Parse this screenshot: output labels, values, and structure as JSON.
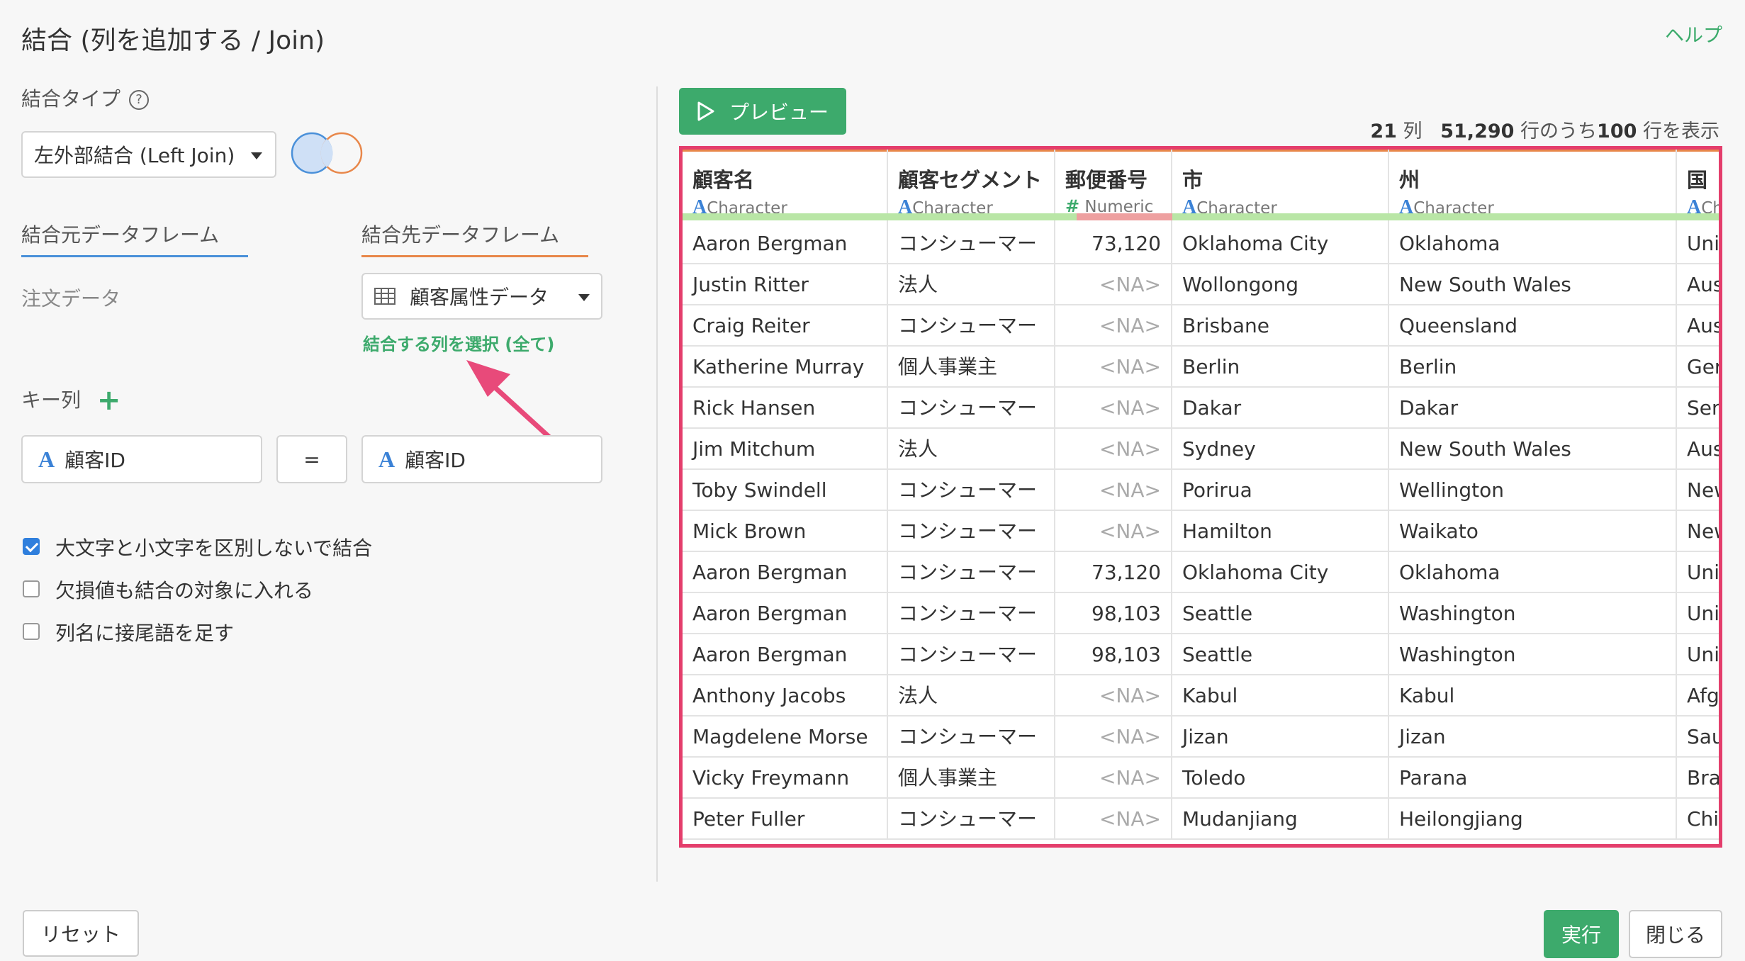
{
  "dialog": {
    "title": "結合 (列を追加する / Join)",
    "help_label": "ヘルプ"
  },
  "join_type": {
    "label": "結合タイプ",
    "help_icon": "?",
    "selected": "左外部結合 (Left Join)"
  },
  "source": {
    "tab_label": "結合元データフレーム",
    "value": "注文データ"
  },
  "target": {
    "tab_label": "結合先データフレーム",
    "selected": "顧客属性データ",
    "select_columns_link": "結合する列を選択 (全て)"
  },
  "key_columns": {
    "label": "キー列",
    "add_icon": "+",
    "left": "顧客ID",
    "operator": "=",
    "right": "顧客ID"
  },
  "options": [
    {
      "label": "大文字と小文字を区別しないで結合",
      "checked": true
    },
    {
      "label": "欠損値も結合の対象に入れる",
      "checked": false
    },
    {
      "label": "列名に接尾語を足す",
      "checked": false
    }
  ],
  "preview": {
    "button_label": "プレビュー",
    "stats": {
      "cols": "21",
      "cols_unit": "列",
      "total": "51,290",
      "total_unit": "行のうち",
      "shown": "100",
      "shown_unit": "行を表示"
    },
    "columns": [
      {
        "name": "顧客名",
        "type": "Character",
        "type_icon": "A"
      },
      {
        "name": "顧客セグメント",
        "type": "Character",
        "type_icon": "A"
      },
      {
        "name": "郵便番号",
        "type": "Numeric",
        "type_icon": "#"
      },
      {
        "name": "市",
        "type": "Character",
        "type_icon": "A"
      },
      {
        "name": "州",
        "type": "Character",
        "type_icon": "A"
      },
      {
        "name": "国",
        "type": "Character",
        "type_icon": "A"
      }
    ],
    "rows": [
      [
        "Aaron Bergman",
        "コンシューマー",
        "73,120",
        "Oklahoma City",
        "Oklahoma",
        "United States"
      ],
      [
        "Justin Ritter",
        "法人",
        "<NA>",
        "Wollongong",
        "New South Wales",
        "Australia"
      ],
      [
        "Craig Reiter",
        "コンシューマー",
        "<NA>",
        "Brisbane",
        "Queensland",
        "Australia"
      ],
      [
        "Katherine Murray",
        "個人事業主",
        "<NA>",
        "Berlin",
        "Berlin",
        "Germany"
      ],
      [
        "Rick Hansen",
        "コンシューマー",
        "<NA>",
        "Dakar",
        "Dakar",
        "Senegal"
      ],
      [
        "Jim Mitchum",
        "法人",
        "<NA>",
        "Sydney",
        "New South Wales",
        "Australia"
      ],
      [
        "Toby Swindell",
        "コンシューマー",
        "<NA>",
        "Porirua",
        "Wellington",
        "New Zealand"
      ],
      [
        "Mick Brown",
        "コンシューマー",
        "<NA>",
        "Hamilton",
        "Waikato",
        "New Zealand"
      ],
      [
        "Aaron Bergman",
        "コンシューマー",
        "73,120",
        "Oklahoma City",
        "Oklahoma",
        "United States"
      ],
      [
        "Aaron Bergman",
        "コンシューマー",
        "98,103",
        "Seattle",
        "Washington",
        "United States"
      ],
      [
        "Aaron Bergman",
        "コンシューマー",
        "98,103",
        "Seattle",
        "Washington",
        "United States"
      ],
      [
        "Anthony Jacobs",
        "法人",
        "<NA>",
        "Kabul",
        "Kabul",
        "Afghanistan"
      ],
      [
        "Magdelene Morse",
        "コンシューマー",
        "<NA>",
        "Jizan",
        "Jizan",
        "Saudi Arabia"
      ],
      [
        "Vicky Freymann",
        "個人事業主",
        "<NA>",
        "Toledo",
        "Parana",
        "Brazil"
      ],
      [
        "Peter Fuller",
        "コンシューマー",
        "<NA>",
        "Mudanjiang",
        "Heilongjiang",
        "China"
      ]
    ]
  },
  "footer": {
    "reset_label": "リセット",
    "run_label": "実行",
    "close_label": "閉じる"
  },
  "colors": {
    "accent_green": "#3daa6c",
    "highlight_border": "#e43e6c",
    "link_blue": "#4a90d9",
    "tab_orange": "#e8874a"
  }
}
